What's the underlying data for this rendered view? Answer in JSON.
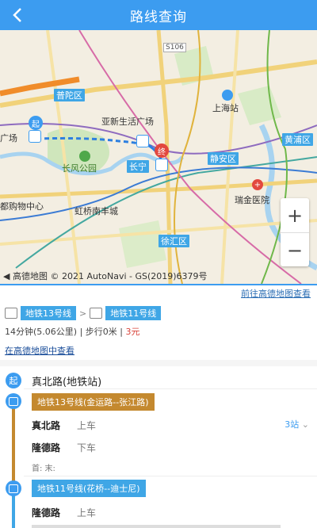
{
  "header": {
    "title": "路线查询"
  },
  "map": {
    "labels": {
      "district_putuo": "普陀区",
      "plaza": "亚新生活广场",
      "park": "长风公园",
      "changning": "长宁",
      "jingan": "静安区",
      "shanghai_station": "上海站",
      "huangpu": "黄浦区",
      "ruijin": "瑞金医院",
      "hongqiao": "虹桥南丰城",
      "mall": "都购物中心",
      "xuhui": "徐汇区",
      "guangchang": "广场",
      "road_code": "S106"
    },
    "start_marker": "起",
    "end_marker": "终",
    "zoom_in": "+",
    "zoom_out": "−",
    "copyright": "◀ 高德地图 © 2021 AutoNavi - GS(2019)6379号"
  },
  "external_link": "前往高德地图查看",
  "summary": {
    "lines": [
      "地铁13号线",
      "地铁11号线"
    ],
    "time_distance": "14分钟(5.06公里)",
    "walk": "步行0米",
    "price": "3元",
    "view_in_map": "在高德地图中查看"
  },
  "detail": {
    "start_badge": "起",
    "start_station": "真北路(地铁站)",
    "segments": [
      {
        "line": "地铁13号线(金运路--张江路)",
        "color": "#c4892f",
        "board_station": "真北路",
        "board_action": "上车",
        "stops": "3站",
        "alight_station": "隆德路",
        "alight_action": "下车",
        "first_last": "首: 末:"
      },
      {
        "line": "地铁11号线(花桥--迪士尼)",
        "color": "#3fa6e6",
        "board_station": "隆德路",
        "board_action": "上车"
      }
    ]
  },
  "colors": {
    "accent": "#3c9cf0",
    "price": "#d8433a"
  }
}
